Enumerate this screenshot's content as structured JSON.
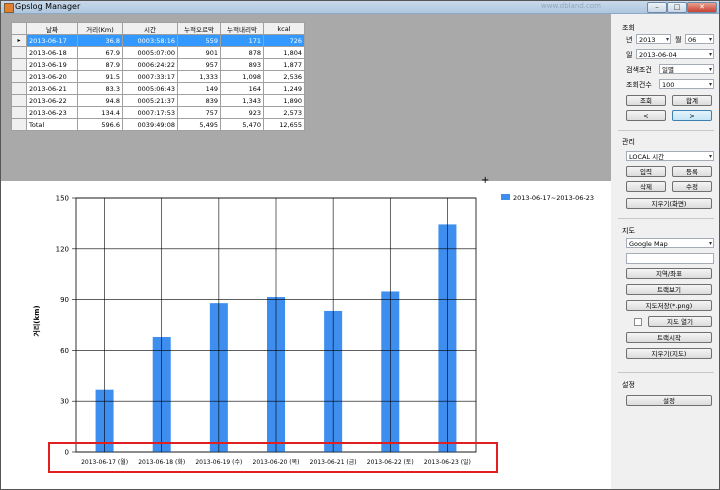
{
  "window": {
    "title": "Gpslog Manager",
    "watermark": "www.dbland.com",
    "btn_min": "–",
    "btn_max": "□",
    "btn_close": "✕"
  },
  "grid": {
    "row_marker": "▸",
    "columns": [
      "날짜",
      "거리(Km)",
      "시간",
      "누적오르막",
      "누적내리막",
      "kcal"
    ],
    "rows": [
      [
        "2013-06-17",
        "36.8",
        "0003:58:16",
        "559",
        "171",
        "726"
      ],
      [
        "2013-06-18",
        "67.9",
        "0005:07:00",
        "901",
        "878",
        "1,804"
      ],
      [
        "2013-06-19",
        "87.9",
        "0006:24:22",
        "957",
        "893",
        "1,877"
      ],
      [
        "2013-06-20",
        "91.5",
        "0007:33:17",
        "1,333",
        "1,098",
        "2,536"
      ],
      [
        "2013-06-21",
        "83.3",
        "0005:06:43",
        "149",
        "164",
        "1,249"
      ],
      [
        "2013-06-22",
        "94.8",
        "0005:21:37",
        "839",
        "1,343",
        "1,890"
      ],
      [
        "2013-06-23",
        "134.4",
        "0007:17:53",
        "757",
        "923",
        "2,573"
      ],
      [
        "Total",
        "596.6",
        "0039:49:08",
        "5,495",
        "5,470",
        "12,655"
      ]
    ]
  },
  "chart_data": {
    "type": "bar",
    "categories": [
      "2013-06-17 (월)",
      "2013-06-18 (화)",
      "2013-06-19 (수)",
      "2013-06-20 (목)",
      "2013-06-21 (금)",
      "2013-06-22 (토)",
      "2013-06-23 (일)"
    ],
    "series": [
      {
        "name": "2013-06-17~2013-06-23",
        "values": [
          36.8,
          67.9,
          87.9,
          91.5,
          83.3,
          94.8,
          134.4
        ]
      }
    ],
    "ylabel": "거리(km)",
    "xlabel": "",
    "yticks": [
      0,
      30,
      60,
      90,
      120,
      150
    ],
    "ylim": [
      0,
      150
    ],
    "grid": true,
    "legend": "top-right",
    "bar_color": "#3e8ef0"
  },
  "highlight_color": "#e02020",
  "crosshair": "+",
  "side": {
    "lookup": {
      "header": "조회",
      "year_label": "년",
      "year_value": "2013",
      "month_label": "월",
      "month_value": "06",
      "day_label": "일",
      "date_value": "2013-06-04",
      "cond_label": "검색조건",
      "cond_value": "일별",
      "count_label": "조회건수",
      "count_value": "100",
      "query_btn": "조회",
      "total_btn": "합계",
      "prev_btn": "<",
      "next_btn": ">"
    },
    "manage": {
      "header": "관리",
      "tz_value": "LOCAL 시간",
      "input_btn": "입력",
      "register_btn": "등록",
      "delete_btn": "삭제",
      "edit_btn": "수정",
      "clear_btn": "지우기(화면)"
    },
    "map": {
      "header": "지도",
      "map_value": "Google Map",
      "region_btn": "지역/좌표",
      "track_view_btn": "트랙보기",
      "save_map_btn": "지도저장(*.png)",
      "open_map_btn": "지도 열기",
      "track_start_btn": "트랙시작",
      "clear_map_btn": "지우기(지도)"
    },
    "settings": {
      "header": "설정",
      "settings_btn": "설정"
    },
    "dropdown_arrow": "▾"
  }
}
